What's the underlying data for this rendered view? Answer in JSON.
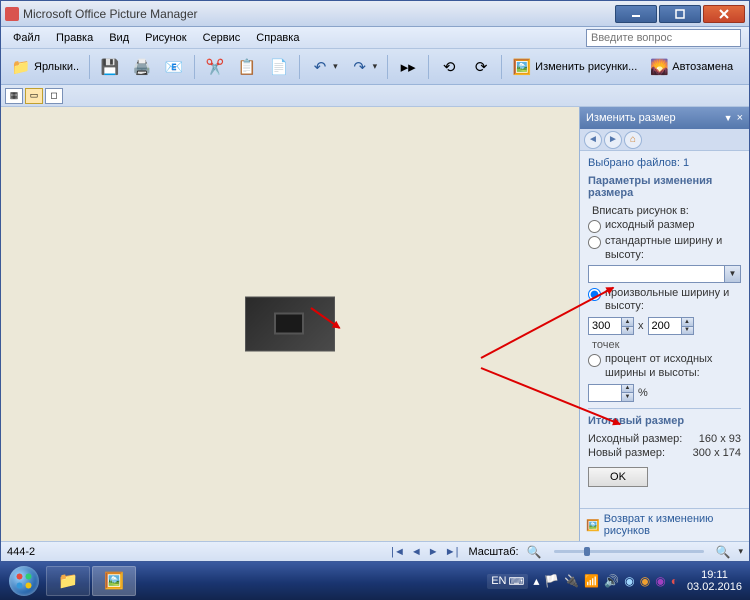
{
  "titlebar": {
    "app_name": "Microsoft Office Picture Manager"
  },
  "menu": {
    "file": "Файл",
    "edit": "Правка",
    "view": "Вид",
    "picture": "Рисунок",
    "tools": "Сервис",
    "help": "Справка"
  },
  "search": {
    "placeholder": "Введите вопрос"
  },
  "toolbar": {
    "shortcuts": "Ярлыки..",
    "edit_pics": "Изменить рисунки...",
    "autoreplace": "Автозамена"
  },
  "sidepanel": {
    "title": "Изменить размер",
    "selected": "Выбрано файлов: 1",
    "section": "Параметры изменения размера",
    "fit_in": "Вписать рисунок в:",
    "opt_original": "исходный размер",
    "opt_standard": "стандартные ширину и высоту:",
    "opt_custom": "произвольные ширину и высоту:",
    "width": "300",
    "height": "200",
    "by": "x",
    "pixels": "точек",
    "opt_percent": "процент от исходных ширины и высоты:",
    "percent_sign": "%",
    "result_title": "Итоговый размер",
    "original_label": "Исходный размер:",
    "original_value": "160 x 93",
    "new_label": "Новый размер:",
    "new_value": "300 x 174",
    "ok": "OK",
    "back_link": "Возврат к изменению рисунков"
  },
  "statusbar": {
    "filename": "444-2",
    "zoom_label": "Масштаб:"
  },
  "taskbar": {
    "lang": "EN",
    "time": "19:11",
    "date": "03.02.2016"
  }
}
